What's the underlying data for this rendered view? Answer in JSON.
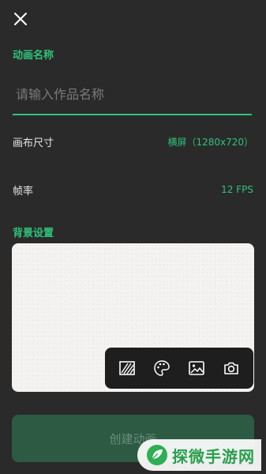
{
  "header": {
    "close_icon": "close-icon"
  },
  "name_section": {
    "label": "动画名称",
    "placeholder": "请输入作品名称",
    "value": ""
  },
  "canvas_size": {
    "label": "画布尺寸",
    "value": "横屏（1280x720）"
  },
  "frame_rate": {
    "label": "帧率",
    "value": "12 FPS"
  },
  "background": {
    "label": "背景设置",
    "tools": [
      "texture-icon",
      "palette-icon",
      "image-icon",
      "camera-icon"
    ]
  },
  "create_button": {
    "label": "创建动画"
  },
  "watermark": {
    "text": "探微手游网"
  },
  "colors": {
    "accent": "#2fc37a",
    "bg": "#2a2a2a",
    "button": "#2c5a43"
  }
}
